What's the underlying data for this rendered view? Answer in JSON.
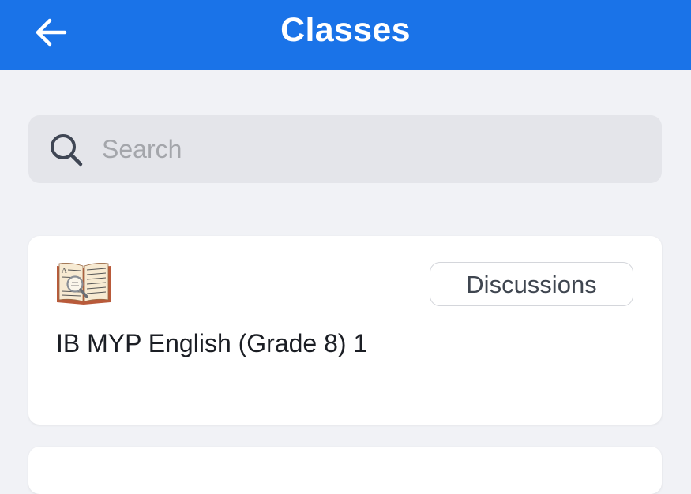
{
  "header": {
    "title": "Classes",
    "back_icon": "arrow-left-icon",
    "background_color": "#1a73e8"
  },
  "search": {
    "placeholder": "Search",
    "value": "",
    "icon": "search-icon"
  },
  "classes": [
    {
      "icon": "book-magnifier-icon",
      "name": "IB MYP English (Grade 8) 1",
      "action_label": "Discussions"
    }
  ]
}
